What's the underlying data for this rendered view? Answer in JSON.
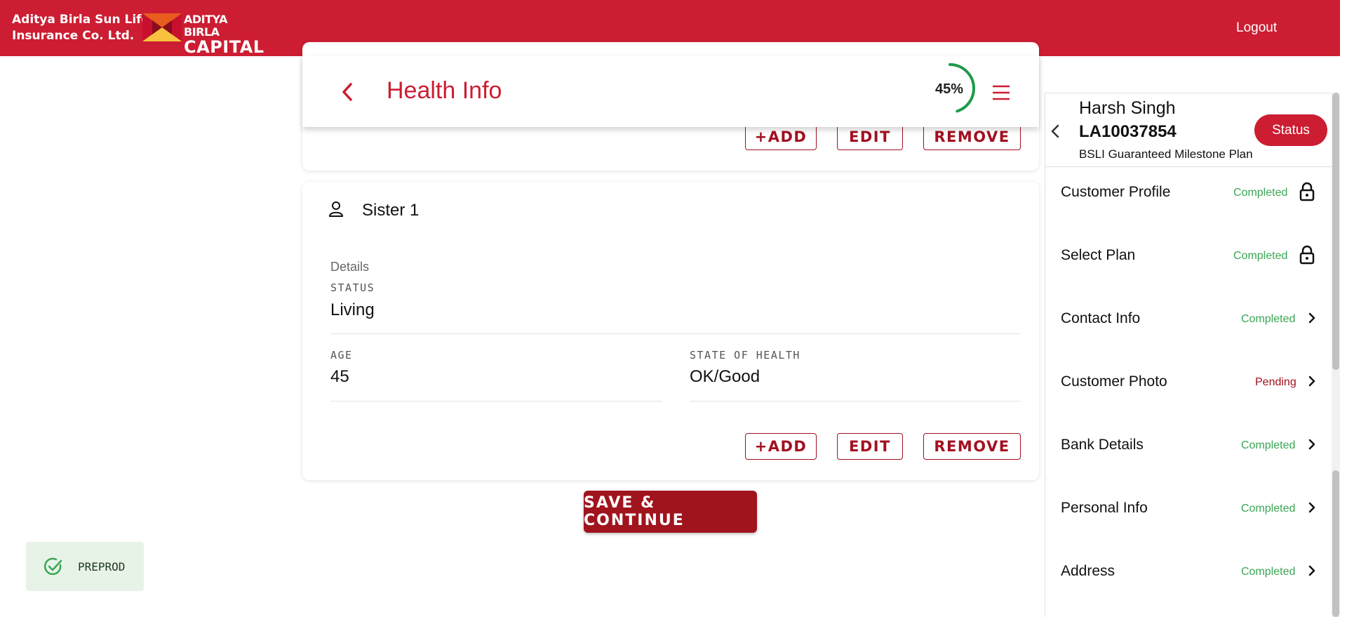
{
  "header": {
    "company_line1": "Aditya Birla Sun Life",
    "company_line2": "Insurance Co. Ltd.",
    "logo_line1": "ADITYA BIRLA",
    "logo_line2": "CAPITAL",
    "logout_label": "Logout",
    "brand_color": "#cc1d32"
  },
  "page": {
    "title": "Health Info",
    "progress_text": "45%",
    "progress_value": 0.45
  },
  "top_card": {
    "add_label": "+ADD",
    "edit_label": "EDIT",
    "remove_label": "REMOVE"
  },
  "sister_card": {
    "title": "Sister 1",
    "details_label": "Details",
    "status_label": "STATUS",
    "status_value": "Living",
    "age_label": "AGE",
    "age_value": "45",
    "health_label": "STATE OF HEALTH",
    "health_value": "OK/Good",
    "add_label": "+ADD",
    "edit_label": "EDIT",
    "remove_label": "REMOVE"
  },
  "actions": {
    "save_label": "SAVE & CONTINUE"
  },
  "environment": {
    "label": "PREPROD"
  },
  "side_panel": {
    "customer_name": "Harsh Singh",
    "application_id": "LA10037854",
    "plan_name": "BSLI Guaranteed Milestone Plan",
    "status_button": "Status",
    "items": [
      {
        "label": "Customer Profile",
        "status": "Completed",
        "icon": "lock-icon"
      },
      {
        "label": "Select Plan",
        "status": "Completed",
        "icon": "lock-icon"
      },
      {
        "label": "Contact Info",
        "status": "Completed",
        "icon": "chevron-right-icon"
      },
      {
        "label": "Customer Photo",
        "status": "Pending",
        "icon": "chevron-right-icon"
      },
      {
        "label": "Bank Details",
        "status": "Completed",
        "icon": "chevron-right-icon"
      },
      {
        "label": "Personal Info",
        "status": "Completed",
        "icon": "chevron-right-icon"
      },
      {
        "label": "Address",
        "status": "Completed",
        "icon": "chevron-right-icon"
      }
    ]
  }
}
